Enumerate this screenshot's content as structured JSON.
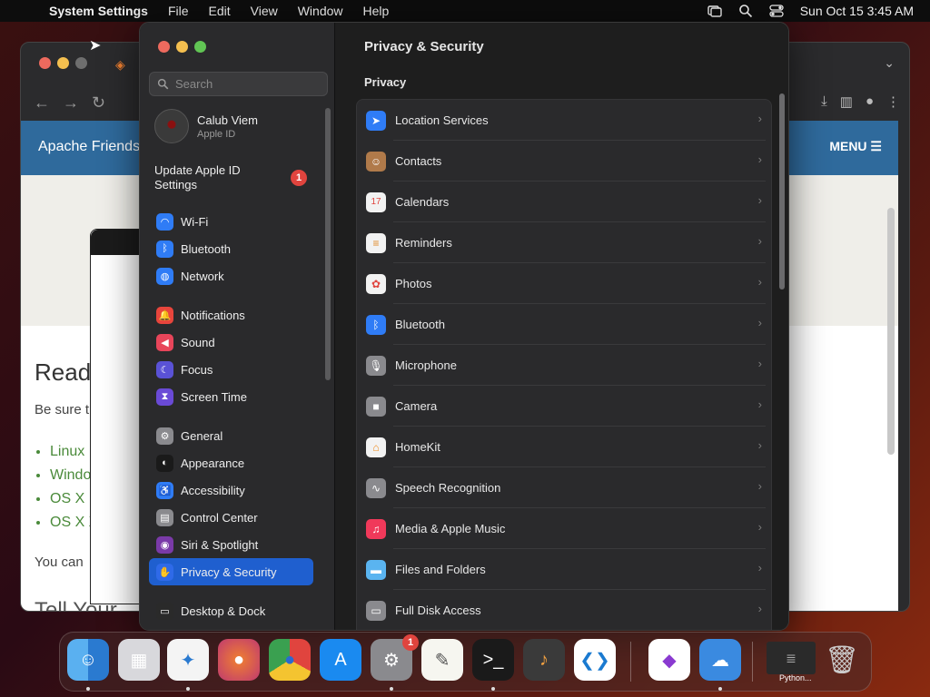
{
  "menubar": {
    "app_name": "System Settings",
    "items": [
      "File",
      "Edit",
      "View",
      "Window",
      "Help"
    ],
    "clock": "Sun Oct 15  3:45 AM"
  },
  "browser": {
    "brand": "Apache Friends",
    "menu_label": "MENU",
    "heading": "Readi",
    "intro": "Be sure t",
    "links": [
      "Linux",
      "Windo",
      "OS X I",
      "OS X X"
    ],
    "note": "You can",
    "footer_heading": "Tell Your"
  },
  "settings": {
    "search": {
      "placeholder": "Search"
    },
    "user": {
      "name": "Calub Viem",
      "subtitle": "Apple ID"
    },
    "update": {
      "label": "Update Apple ID Settings",
      "badge": "1"
    },
    "sidebar": [
      {
        "label": "Wi-Fi",
        "icon": "wifi-icon",
        "color": "#2f7cf6"
      },
      {
        "label": "Bluetooth",
        "icon": "bluetooth-icon",
        "color": "#2f7cf6"
      },
      {
        "label": "Network",
        "icon": "globe-icon",
        "color": "#2f7cf6"
      },
      {
        "label": "Notifications",
        "icon": "bell-icon",
        "color": "#e8453c"
      },
      {
        "label": "Sound",
        "icon": "speaker-icon",
        "color": "#e8455a"
      },
      {
        "label": "Focus",
        "icon": "moon-icon",
        "color": "#5a52d6"
      },
      {
        "label": "Screen Time",
        "icon": "hourglass-icon",
        "color": "#6a4ad6"
      },
      {
        "label": "General",
        "icon": "gear-icon",
        "color": "#8a8a8e"
      },
      {
        "label": "Appearance",
        "icon": "appearance-icon",
        "color": "#1a1a1a"
      },
      {
        "label": "Accessibility",
        "icon": "accessibility-icon",
        "color": "#2f7cf6"
      },
      {
        "label": "Control Center",
        "icon": "toggles-icon",
        "color": "#8a8a8e"
      },
      {
        "label": "Siri & Spotlight",
        "icon": "siri-icon",
        "color": "#7a3aa8"
      },
      {
        "label": "Privacy & Security",
        "icon": "hand-icon",
        "color": "#2f6ae8"
      },
      {
        "label": "Desktop & Dock",
        "icon": "dock-icon",
        "color": "#2a2a2a"
      }
    ],
    "panel_title": "Privacy & Security",
    "section_title": "Privacy",
    "rows": [
      {
        "label": "Location Services",
        "icon": "location-arrow-icon",
        "color": "#2f7cf6"
      },
      {
        "label": "Contacts",
        "icon": "contacts-icon",
        "color": "#b07a4a"
      },
      {
        "label": "Calendars",
        "icon": "calendar-icon",
        "color": "#f2f2f2"
      },
      {
        "label": "Reminders",
        "icon": "reminders-icon",
        "color": "#f2f2f2"
      },
      {
        "label": "Photos",
        "icon": "photos-icon",
        "color": "#f2f2f2"
      },
      {
        "label": "Bluetooth",
        "icon": "bluetooth-icon",
        "color": "#2f7cf6"
      },
      {
        "label": "Microphone",
        "icon": "microphone-icon",
        "color": "#8a8a8e"
      },
      {
        "label": "Camera",
        "icon": "camera-icon",
        "color": "#8a8a8e"
      },
      {
        "label": "HomeKit",
        "icon": "home-icon",
        "color": "#f2f2f2"
      },
      {
        "label": "Speech Recognition",
        "icon": "waveform-icon",
        "color": "#8a8a8e"
      },
      {
        "label": "Media & Apple Music",
        "icon": "music-note-icon",
        "color": "#f0395a"
      },
      {
        "label": "Files and Folders",
        "icon": "folder-icon",
        "color": "#5ab4f0"
      },
      {
        "label": "Full Disk Access",
        "icon": "disk-icon",
        "color": "#8a8a8e"
      }
    ]
  },
  "dock": {
    "apps": [
      "Finder",
      "Launchpad",
      "Safari",
      "Firefox",
      "Chrome",
      "App Store",
      "System Settings",
      "TextEdit",
      "Terminal",
      "GarageBand",
      "Visual Studio Code",
      "Visual Studio",
      "Weather",
      "Python",
      "Trash"
    ],
    "settings_badge": "1",
    "python_label": "Python..."
  }
}
